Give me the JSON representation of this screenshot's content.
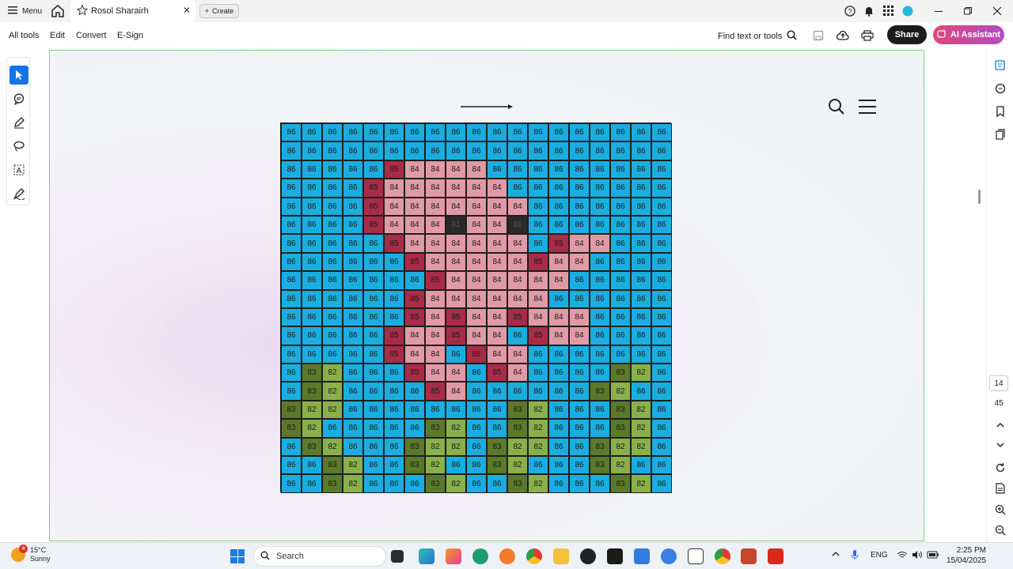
{
  "titlebar": {
    "menu_label": "Menu",
    "tab_title": "Rosol Sharairh",
    "create_label": "Create",
    "icons": [
      "help-icon",
      "bell-icon",
      "apps-grid-icon",
      "profile-icon",
      "minimize-icon",
      "restore-icon",
      "close-icon"
    ]
  },
  "toolbar": {
    "menus": [
      "All tools",
      "Edit",
      "Convert",
      "E-Sign"
    ],
    "find_label": "Find text or tools",
    "share_label": "Share",
    "ai_label": "AI Assistant"
  },
  "right_rail": {
    "page_current": "14",
    "page_total": "45"
  },
  "grid_rows": [
    [
      "86",
      "86",
      "86",
      "86",
      "86",
      "86",
      "86",
      "86",
      "86",
      "86",
      "86",
      "86",
      "86",
      "86",
      "86",
      "86",
      "86",
      "86",
      "86"
    ],
    [
      "86",
      "86",
      "86",
      "86",
      "86",
      "86",
      "86",
      "86",
      "86",
      "86",
      "86",
      "86",
      "86",
      "86",
      "86",
      "86",
      "86",
      "86",
      "86"
    ],
    [
      "86",
      "86",
      "86",
      "86",
      "86",
      "85",
      "84",
      "84",
      "84",
      "84",
      "86",
      "86",
      "86",
      "86",
      "86",
      "86",
      "86",
      "86",
      "86"
    ],
    [
      "86",
      "86",
      "86",
      "86",
      "85",
      "84",
      "84",
      "84",
      "84",
      "84",
      "84",
      "86",
      "86",
      "86",
      "86",
      "86",
      "86",
      "86",
      "86"
    ],
    [
      "86",
      "86",
      "86",
      "86",
      "85",
      "84",
      "84",
      "84",
      "84",
      "84",
      "84",
      "84",
      "86",
      "86",
      "86",
      "86",
      "86",
      "86",
      "86"
    ],
    [
      "86",
      "86",
      "86",
      "86",
      "85",
      "84",
      "84",
      "84",
      "81",
      "84",
      "84",
      "81",
      "86",
      "86",
      "86",
      "86",
      "86",
      "86",
      "86"
    ],
    [
      "86",
      "86",
      "86",
      "86",
      "86",
      "85",
      "84",
      "84",
      "84",
      "84",
      "84",
      "84",
      "86",
      "85",
      "84",
      "84",
      "86",
      "86",
      "86"
    ],
    [
      "86",
      "86",
      "86",
      "86",
      "86",
      "86",
      "85",
      "84",
      "84",
      "84",
      "84",
      "84",
      "85",
      "84",
      "84",
      "86",
      "86",
      "86",
      "86"
    ],
    [
      "86",
      "86",
      "86",
      "86",
      "86",
      "86",
      "86",
      "85",
      "84",
      "84",
      "84",
      "84",
      "84",
      "84",
      "86",
      "86",
      "86",
      "86",
      "86"
    ],
    [
      "86",
      "86",
      "86",
      "86",
      "86",
      "86",
      "85",
      "84",
      "84",
      "84",
      "84",
      "84",
      "84",
      "86",
      "86",
      "86",
      "86",
      "86",
      "86"
    ],
    [
      "86",
      "86",
      "86",
      "86",
      "86",
      "86",
      "85",
      "84",
      "85",
      "84",
      "84",
      "85",
      "84",
      "84",
      "84",
      "86",
      "86",
      "86",
      "86"
    ],
    [
      "86",
      "86",
      "86",
      "86",
      "86",
      "85",
      "84",
      "84",
      "85",
      "84",
      "84",
      "86",
      "85",
      "84",
      "84",
      "86",
      "86",
      "86",
      "86"
    ],
    [
      "86",
      "86",
      "86",
      "86",
      "86",
      "85",
      "84",
      "84",
      "86",
      "85",
      "84",
      "84",
      "86",
      "86",
      "86",
      "86",
      "86",
      "86",
      "86"
    ],
    [
      "86",
      "83",
      "82",
      "86",
      "86",
      "86",
      "85",
      "84",
      "84",
      "86",
      "85",
      "84",
      "86",
      "86",
      "86",
      "86",
      "83",
      "82",
      "86"
    ],
    [
      "86",
      "83",
      "82",
      "86",
      "86",
      "86",
      "86",
      "85",
      "84",
      "86",
      "86",
      "86",
      "86",
      "86",
      "86",
      "83",
      "82",
      "86",
      "86"
    ],
    [
      "83",
      "82",
      "82",
      "86",
      "86",
      "86",
      "86",
      "86",
      "86",
      "86",
      "86",
      "83",
      "82",
      "86",
      "86",
      "86",
      "83",
      "82",
      "86"
    ],
    [
      "83",
      "82",
      "86",
      "86",
      "86",
      "86",
      "86",
      "83",
      "82",
      "86",
      "86",
      "83",
      "82",
      "86",
      "86",
      "86",
      "83",
      "82",
      "86"
    ],
    [
      "86",
      "83",
      "82",
      "86",
      "86",
      "86",
      "83",
      "82",
      "82",
      "86",
      "83",
      "82",
      "82",
      "86",
      "86",
      "83",
      "82",
      "82",
      "86"
    ],
    [
      "86",
      "86",
      "83",
      "82",
      "86",
      "86",
      "83",
      "82",
      "86",
      "86",
      "83",
      "82",
      "86",
      "86",
      "86",
      "83",
      "82",
      "86",
      "86"
    ],
    [
      "86",
      "86",
      "83",
      "82",
      "86",
      "86",
      "86",
      "83",
      "82",
      "86",
      "86",
      "83",
      "82",
      "86",
      "86",
      "86",
      "83",
      "82",
      "86"
    ]
  ],
  "cell_colors": {
    "86": "#1aaee0",
    "85": "#a82c48",
    "84": "#e09aa6",
    "83": "#5a7a2a",
    "82": "#8ab04a",
    "81": "#2a2a2a"
  },
  "taskbar": {
    "weather_temp": "15°C",
    "weather_desc": "Sunny",
    "weather_badge": "4",
    "search_label": "Search",
    "language": "ENG",
    "time": "2:25 PM",
    "date": "15/04/2025"
  }
}
